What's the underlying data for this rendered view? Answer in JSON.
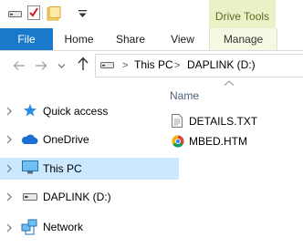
{
  "contextual_tab_header": "Drive Tools",
  "ribbon": {
    "tabs": [
      "File",
      "Home",
      "Share",
      "View",
      "Manage"
    ]
  },
  "address": {
    "segments": [
      "This PC",
      "DAPLINK (D:)"
    ]
  },
  "nav_pane": {
    "items": [
      {
        "label": "Quick access",
        "icon": "star-icon"
      },
      {
        "label": "OneDrive",
        "icon": "cloud-icon"
      },
      {
        "label": "This PC",
        "icon": "monitor-icon",
        "selected": true
      },
      {
        "label": "DAPLINK (D:)",
        "icon": "drive-icon"
      },
      {
        "label": "Network",
        "icon": "network-icon"
      }
    ]
  },
  "file_pane": {
    "column_header": "Name",
    "files": [
      {
        "name": "DETAILS.TXT",
        "icon": "text-file-icon"
      },
      {
        "name": "MBED.HTM",
        "icon": "chrome-icon"
      }
    ]
  },
  "colors": {
    "file_tab": "#1979ca",
    "selection": "#cce8ff",
    "contextual_header": "#e9f1c7"
  }
}
